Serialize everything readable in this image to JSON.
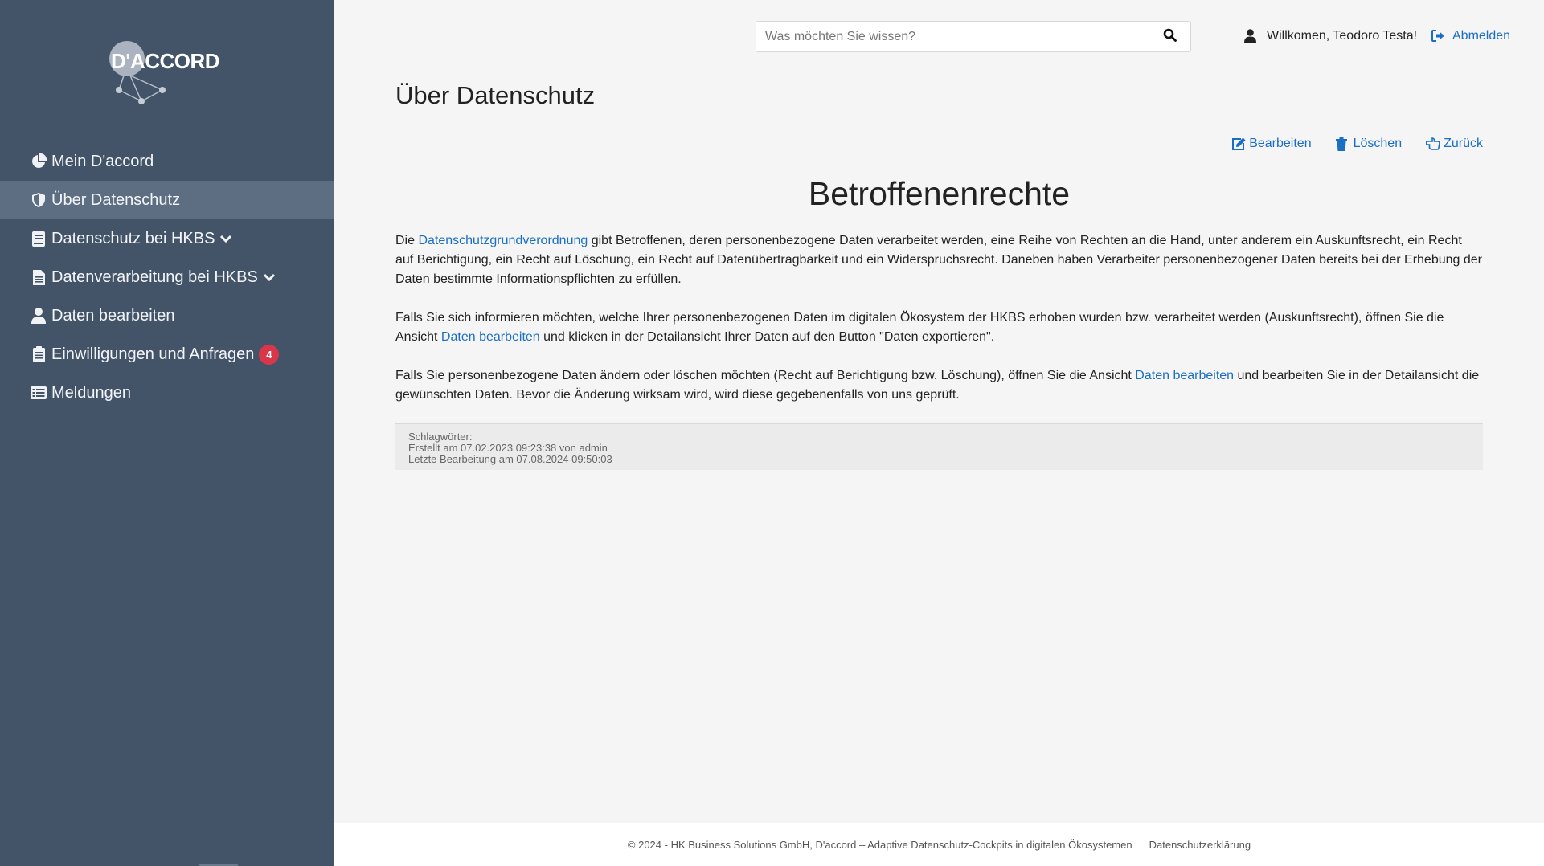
{
  "brand": {
    "logo_text": "D'ACCORD"
  },
  "sidebar": {
    "items": [
      {
        "label": "Mein D'accord",
        "icon": "pie-chart-icon",
        "active": false
      },
      {
        "label": "Über Datenschutz",
        "icon": "shield-icon",
        "active": true
      },
      {
        "label": "Datenschutz bei HKBS",
        "icon": "book-icon",
        "active": false,
        "expandable": true
      },
      {
        "label": "Datenverarbeitung bei HKBS",
        "icon": "document-icon",
        "active": false,
        "expandable": true
      },
      {
        "label": "Daten bearbeiten",
        "icon": "user-icon",
        "active": false
      },
      {
        "label": "Einwilligungen und Anfragen",
        "icon": "clipboard-icon",
        "active": false,
        "badge": "4"
      },
      {
        "label": "Meldungen",
        "icon": "list-icon",
        "active": false
      }
    ]
  },
  "header": {
    "search": {
      "placeholder": "Was möchten Sie wissen?",
      "value": ""
    },
    "welcome": "Willkomen, Teodoro Testa!",
    "logout": "Abmelden"
  },
  "page": {
    "title": "Über Datenschutz",
    "actions": {
      "edit": "Bearbeiten",
      "delete": "Löschen",
      "back": "Zurück"
    },
    "heading": "Betroffenenrechte",
    "p1": {
      "pre": "Die ",
      "link": "Datenschutzgrundverordnung",
      "post": " gibt Betroffenen, deren personenbezogene Daten verarbeitet werden, eine Reihe von Rechten an die Hand, unter anderem ein Auskunftsrecht, ein Recht auf Berichtigung, ein Recht auf Löschung, ein Recht auf Datenübertragbarkeit und ein Widerspruchsrecht. Daneben haben Verarbeiter personenbezogener Daten bereits bei der Erhebung der Daten bestimmte Informationspflichten zu erfüllen."
    },
    "p2": {
      "pre": "Falls Sie sich informieren möchten, welche Ihrer personenbezogenen Daten im digitalen Ökosystem der HKBS erhoben wurden bzw. verarbeitet werden (Auskunftsrecht), öffnen Sie die Ansicht ",
      "link": "Daten bearbeiten",
      "post": " und klicken in der Detailansicht Ihrer Daten auf den Button \"Daten exportieren\"."
    },
    "p3": {
      "pre": "Falls Sie personenbezogene Daten ändern oder löschen möchten (Recht auf Berichtigung bzw. Löschung), öffnen Sie die Ansicht ",
      "link": "Daten bearbeiten",
      "post": " und bearbeiten Sie in der Detailansicht die gewünschten Daten. Bevor die Änderung wirksam wird, wird diese gegebenenfalls von uns geprüft."
    },
    "meta": {
      "tags": "Schlagwörter:",
      "created": "Erstellt am 07.02.2023 09:23:38 von admin",
      "updated": "Letzte Bearbeitung am 07.08.2024 09:50:03"
    }
  },
  "footer": {
    "copyright": "© 2024 - HK Business Solutions GmbH, D'accord – Adaptive Datenschutz-Cockpits in digitalen Ökosystemen",
    "privacy": "Datenschutzerklärung"
  },
  "colors": {
    "sidebar": "#435469",
    "sidebar_active": "#5e6e82",
    "link": "#1a6ec4",
    "badge": "#d9364a"
  }
}
